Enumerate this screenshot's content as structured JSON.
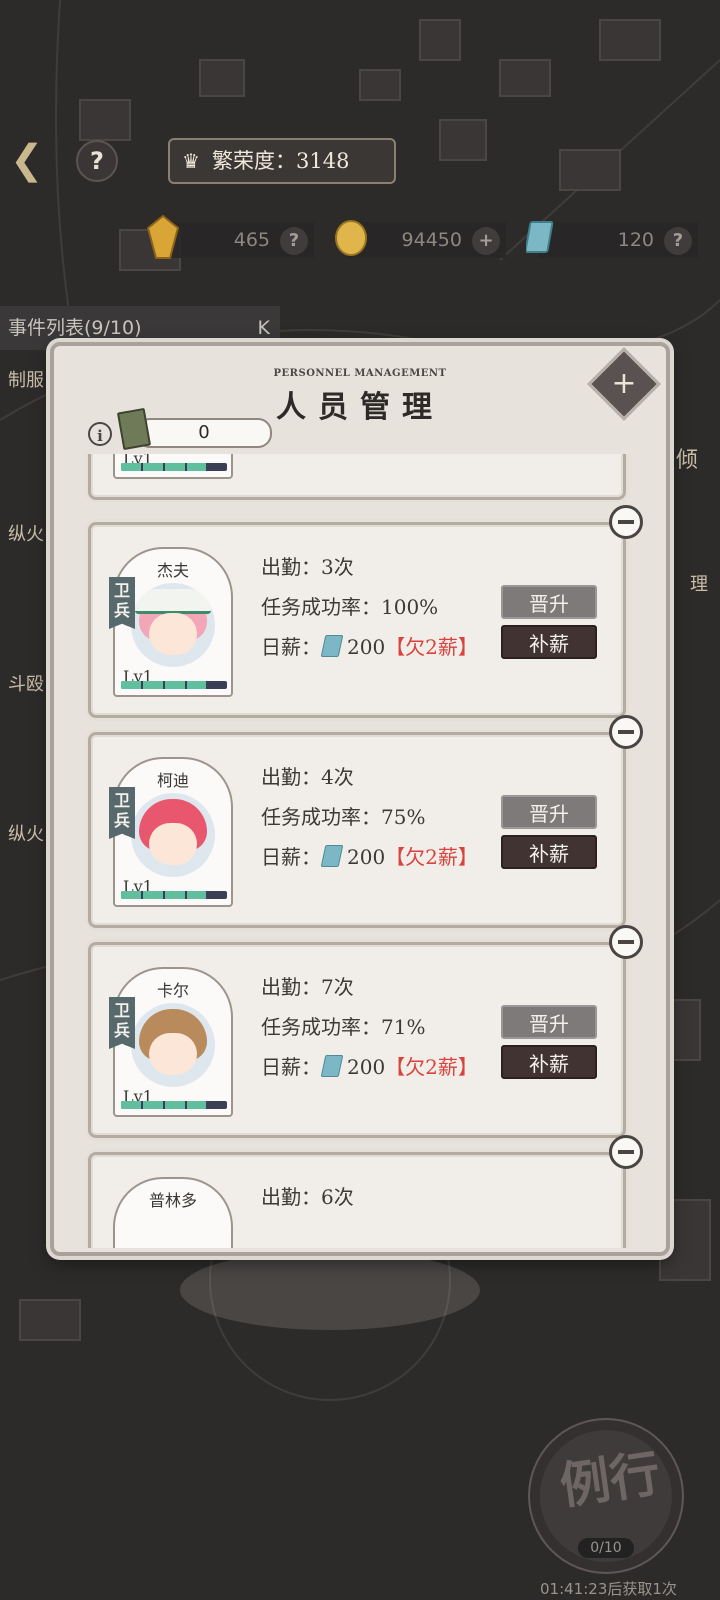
{
  "hud": {
    "prosperity": "繁荣度：3148",
    "help": "?",
    "resources": [
      {
        "icon": "gem-icon",
        "value": "465",
        "action": "?"
      },
      {
        "icon": "gold-coin-icon",
        "value": "94450",
        "action": "+"
      },
      {
        "icon": "ticket-icon",
        "value": "120",
        "action": "?"
      }
    ],
    "event_list": "事件列表(9/10)",
    "event_collapse": "K",
    "side_labels": [
      "制服",
      "纵火",
      "斗殴",
      "纵火",
      "倾",
      "理"
    ],
    "routine": {
      "label": "例行",
      "count": "0/10",
      "countdown": "01:41:23后获取1次"
    }
  },
  "panel": {
    "subtitle": "PERSONNEL MANAGEMENT",
    "title": "人员管理",
    "book_count": "0",
    "labels": {
      "attendance": "出勤：",
      "success": "任务成功率：",
      "salary": "日薪：",
      "promote": "晋升",
      "pay": "补薪",
      "role": "卫兵",
      "level": "Lv1"
    },
    "cards": [
      {
        "name": "杰夫",
        "attendance": "3次",
        "success": "100%",
        "salary": "200",
        "owed": "【欠2薪】",
        "xp": 0.8,
        "hair": "#f3a6b8"
      },
      {
        "name": "柯迪",
        "attendance": "4次",
        "success": "75%",
        "salary": "200",
        "owed": "【欠2薪】",
        "xp": 0.8,
        "hair": "#e8576d"
      },
      {
        "name": "卡尔",
        "attendance": "7次",
        "success": "71%",
        "salary": "200",
        "owed": "【欠2薪】",
        "xp": 0.8,
        "hair": "#b98a5c"
      },
      {
        "name": "普林多",
        "attendance": "6次"
      }
    ]
  }
}
